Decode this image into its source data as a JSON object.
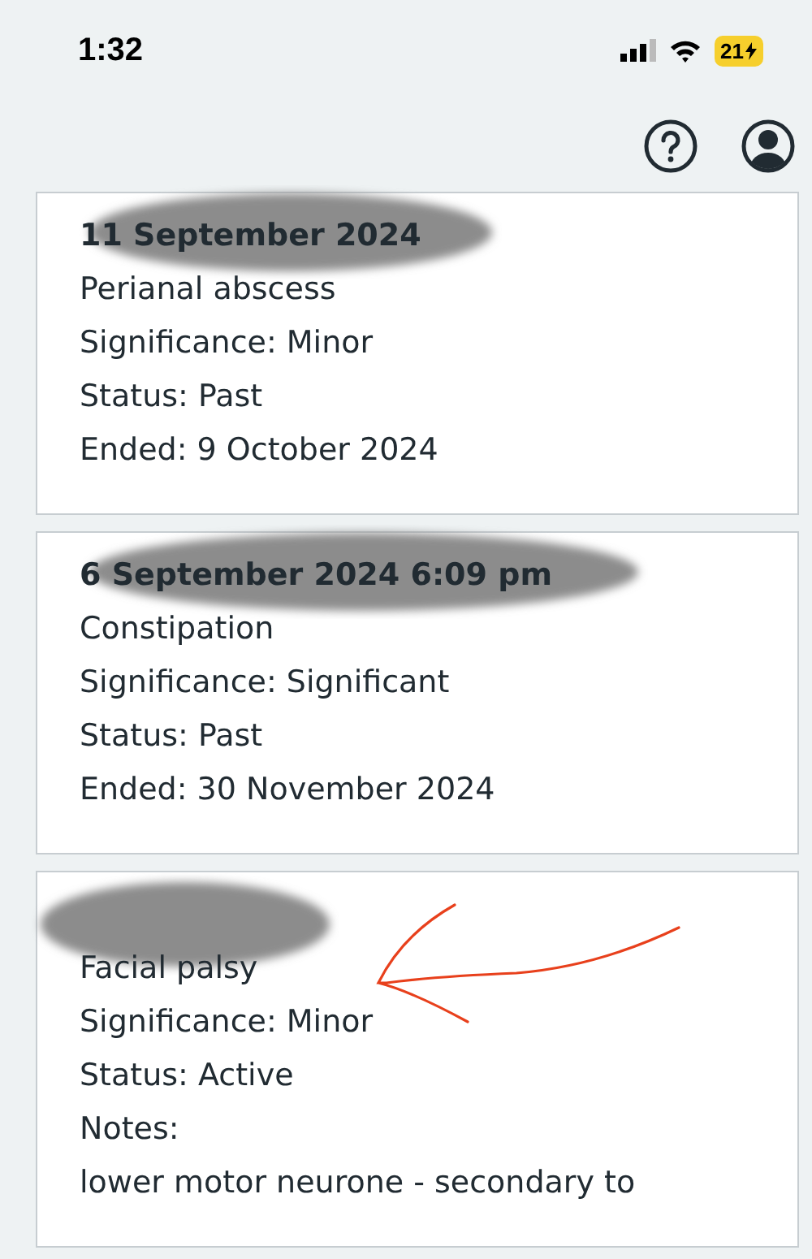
{
  "status_bar": {
    "time": "1:32",
    "battery": "21"
  },
  "cards": [
    {
      "date": "11 September 2024",
      "lines": [
        "Perianal abscess",
        "Significance: Minor",
        "Status: Past",
        "Ended: 9 October 2024"
      ]
    },
    {
      "date": "6 September 2024 6:09 pm",
      "lines": [
        "Constipation",
        "Significance: Significant",
        "Status: Past",
        "Ended: 30 November 2024"
      ]
    },
    {
      "lines": [
        "Facial palsy",
        "Significance: Minor",
        "Status: Active",
        "Notes:",
        "lower motor neurone - secondary to"
      ]
    }
  ]
}
